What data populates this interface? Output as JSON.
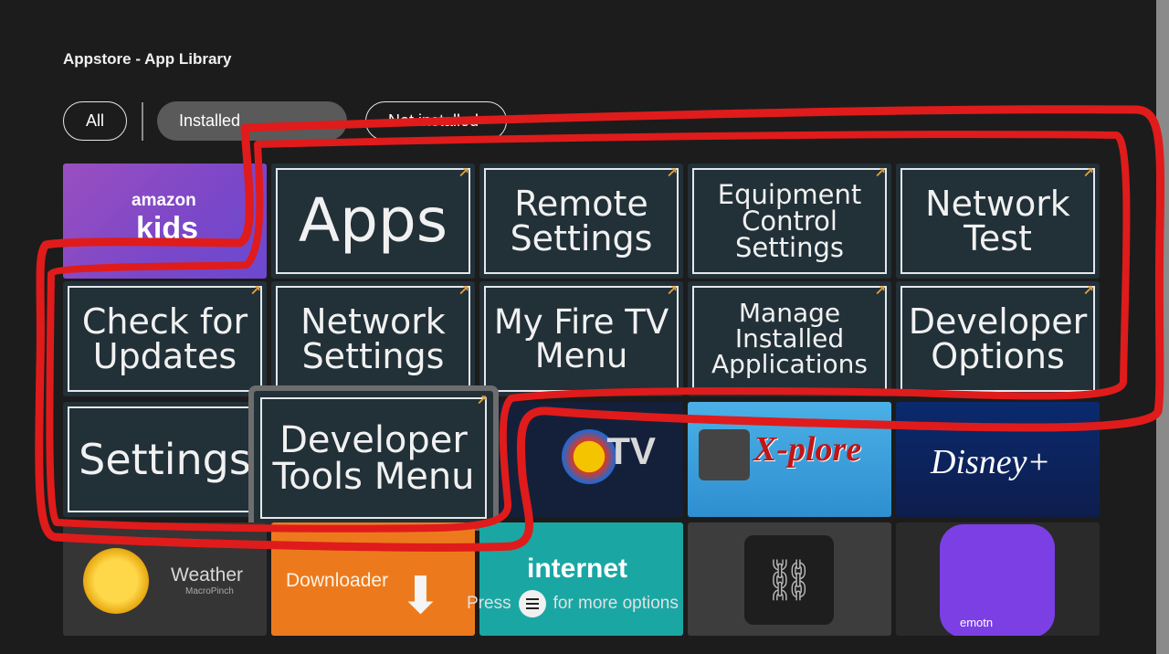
{
  "header": {
    "title": "Appstore - App Library"
  },
  "filters": {
    "all": "All",
    "installed": "Installed",
    "not_installed": "Not installed"
  },
  "apps": {
    "amazon_kids": {
      "line1": "amazon",
      "line2": "kids"
    },
    "dev_tiles": [
      {
        "label": "Apps"
      },
      {
        "label": "Remote Settings"
      },
      {
        "label": "Equipment Control Settings"
      },
      {
        "label": "Network Test"
      },
      {
        "label": "Check for Updates"
      },
      {
        "label": "Network Settings"
      },
      {
        "label": "My Fire TV Menu"
      },
      {
        "label": "Manage Installed Applications"
      },
      {
        "label": "Developer Options"
      },
      {
        "label": "Settings"
      },
      {
        "label": "Developer Tools Menu"
      }
    ],
    "redbull": {
      "label": "TV"
    },
    "xplore": {
      "label": "X-plore"
    },
    "disney": {
      "label": "Disney+"
    },
    "weather": {
      "label": "Weather",
      "sub": "MacroPinch"
    },
    "downloader": {
      "label": "Downloader"
    },
    "internet": {
      "label": "internet"
    },
    "emotn": {
      "label": "emotn"
    }
  },
  "hint": {
    "prefix": "Press",
    "suffix": "for more options"
  },
  "colors": {
    "annotation": "#e01b1b",
    "arrow_badge": "#e8a13a",
    "tile_bg": "#223038"
  },
  "icons": {
    "menu": "menu-icon",
    "external": "external-arrow-icon",
    "unlink": "unlink-icon"
  }
}
